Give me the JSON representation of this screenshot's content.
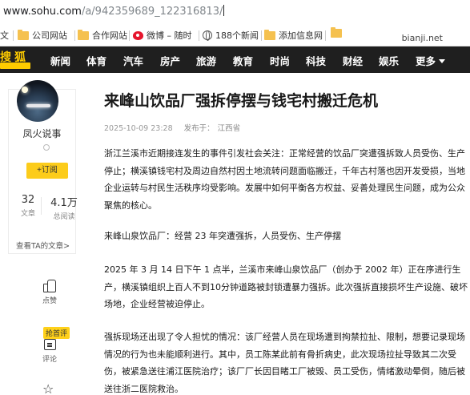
{
  "browser": {
    "url_host": "www.sohu.com",
    "url_path": "/a/942359689_122316813/"
  },
  "bookmarks": {
    "items": [
      {
        "label": "文",
        "icon": "folder-icon"
      },
      {
        "label": "公司网站",
        "icon": "folder-icon"
      },
      {
        "label": "合作网站",
        "icon": "folder-icon"
      },
      {
        "label": "微博 – 随时",
        "icon": "weibo-icon"
      },
      {
        "label": "188个新闻",
        "icon": "globe-icon"
      },
      {
        "label": "添加信息网",
        "icon": "folder-icon"
      }
    ],
    "watermark": "bianji.net"
  },
  "channel_nav": {
    "logo": "搜狐",
    "items": [
      "新闻",
      "体育",
      "汽车",
      "房产",
      "旅游",
      "教育",
      "时尚",
      "科技",
      "财经",
      "娱乐",
      "更多"
    ]
  },
  "author": {
    "name": "凤火说事",
    "follow_label": "+订阅",
    "articles_count": "32",
    "articles_label": "文章",
    "views_count": "4.1万",
    "views_label": "总阅读",
    "see_all": "查看TA的文章>"
  },
  "side_actions": {
    "like_label": "点赞",
    "hot_badge": "抢首评",
    "comment_label": "评论"
  },
  "article": {
    "title": "来峰山饮品厂强拆停摆与钱宅村搬迁危机",
    "date": "2025-10-09 23:28",
    "published_prefix": "发布于：",
    "location": "江西省",
    "paragraphs": [
      "浙江兰溪市近期接连发生的事件引发社会关注：正常经营的饮品厂突遭强拆致人员受伤、生产停止；横溪镇钱宅村及周边自然村因土地流转问题面临搬迁，千年古村落也因开发受损，当地企业运转与村民生活秩序均受影响。发展中如何平衡各方权益、妥善处理民生问题，成为公众聚焦的核心。",
      "来峰山泉饮品厂：经营 23 年突遭强拆，人员受伤、生产停摆",
      "2025 年 3 月 14 日下午 1 点半，兰溪市来峰山泉饮品厂（创办于 2002 年）正在序进行生产，横溪镇组织上百人不到10分钟道路被封锁遭暴力强拆。此次强拆直接损坏生产设施、破坏场地，企业经营被迫停止。",
      "强拆现场还出现了令人担忧的情况：该厂经营人员在现场遭到拘禁拉扯、限制，想要记录现场情况的行为也未能顺利进行。其中，员工陈某此前有骨折病史，此次现场拉扯导致其二次受伤，被紧急送往浦江医院治疗；该厂厂长因目睹工厂被毁、员工受伤，情绪激动晕倒，随后被送往浙二医院救治。"
    ]
  }
}
